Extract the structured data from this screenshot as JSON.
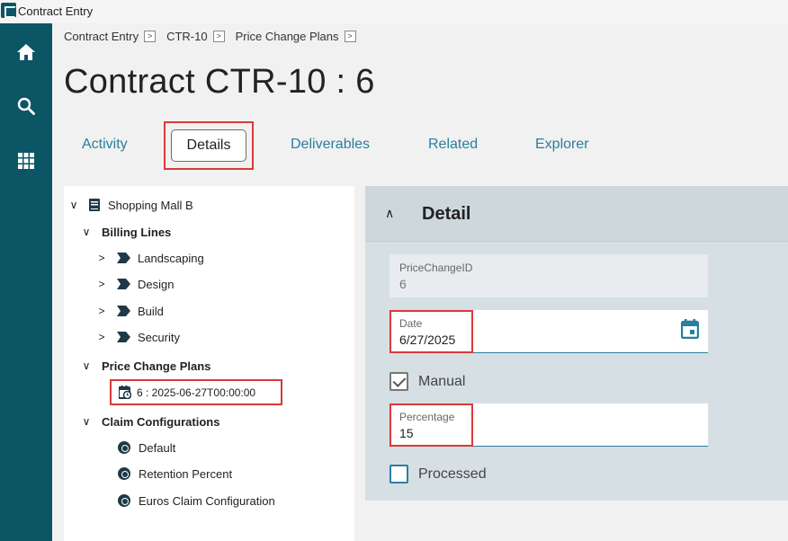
{
  "window": {
    "title": "Contract Entry"
  },
  "nav": {
    "icons": [
      "home-icon",
      "search-icon",
      "apps-grid-icon"
    ]
  },
  "breadcrumb": {
    "items": [
      "Contract Entry",
      "CTR-10",
      "Price Change Plans"
    ]
  },
  "page": {
    "title": "Contract CTR-10 : 6"
  },
  "tabs": {
    "activity": "Activity",
    "details": "Details",
    "deliverables": "Deliverables",
    "related": "Related",
    "explorer": "Explorer"
  },
  "tree": {
    "root": "Shopping Mall B",
    "billing_lines": {
      "label": "Billing Lines",
      "items": [
        "Landscaping",
        "Design",
        "Build",
        "Security"
      ]
    },
    "price_change_plans": {
      "label": "Price Change Plans",
      "items": [
        "6 : 2025-06-27T00:00:00"
      ]
    },
    "claim_configurations": {
      "label": "Claim Configurations",
      "items": [
        "Default",
        "Retention Percent",
        "Euros Claim Configuration"
      ]
    }
  },
  "detail": {
    "title": "Detail",
    "price_change_id": {
      "label": "PriceChangeID",
      "value": "6"
    },
    "date": {
      "label": "Date",
      "value": "6/27/2025"
    },
    "manual": {
      "label": "Manual",
      "checked": true
    },
    "percentage": {
      "label": "Percentage",
      "value": "15"
    },
    "processed": {
      "label": "Processed",
      "checked": false
    }
  },
  "colors": {
    "nav_bg": "#0b5565",
    "accent": "#2a7e9e",
    "highlight": "#d83a3a"
  }
}
